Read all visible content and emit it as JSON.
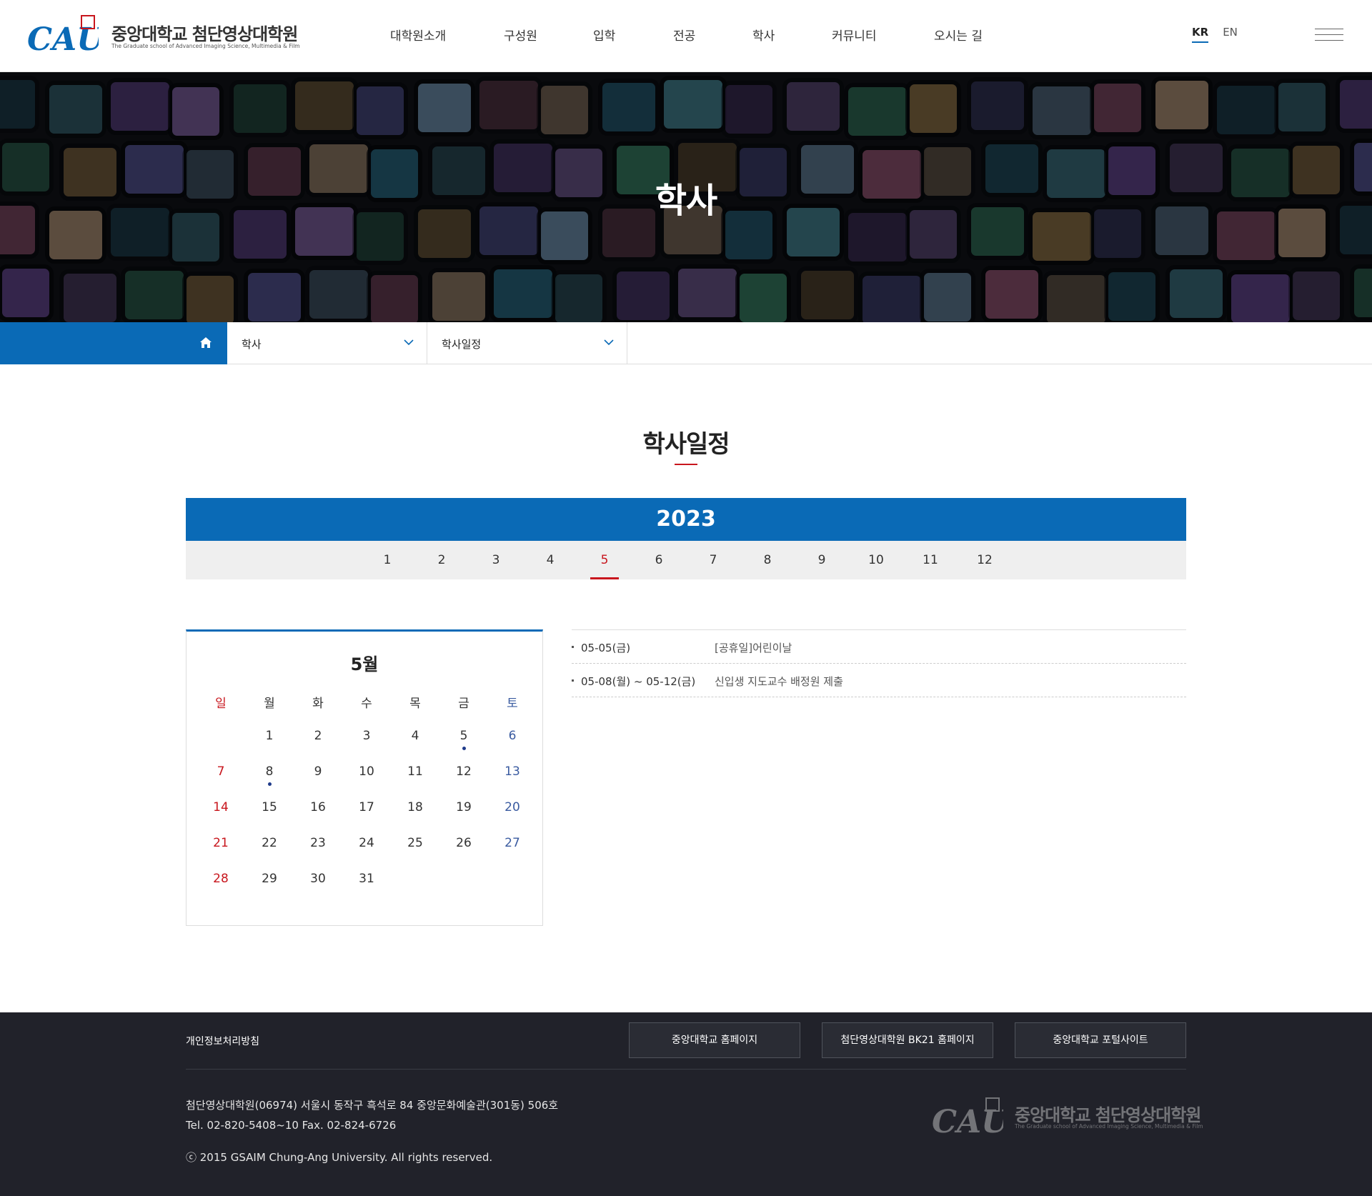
{
  "header": {
    "logo": {
      "mark": "CAU",
      "name_ko": "중앙대학교 첨단영상대학원",
      "name_en": "The Graduate school of Advanced Imaging Science, Multimedia & Film"
    },
    "nav": [
      "대학원소개",
      "구성원",
      "입학",
      "전공",
      "학사",
      "커뮤니티",
      "오시는 길"
    ],
    "lang": {
      "kr": "KR",
      "en": "EN",
      "active": "KR"
    }
  },
  "hero": {
    "title": "학사"
  },
  "breadcrumb": {
    "level1": "학사",
    "level2": "학사일정"
  },
  "page": {
    "title": "학사일정"
  },
  "schedule": {
    "year": "2023",
    "months": [
      "1",
      "2",
      "3",
      "4",
      "5",
      "6",
      "7",
      "8",
      "9",
      "10",
      "11",
      "12"
    ],
    "active_month": "5"
  },
  "calendar": {
    "title": "5월",
    "weekdays": [
      "일",
      "월",
      "화",
      "수",
      "목",
      "금",
      "토"
    ],
    "first_weekday": 1,
    "days": 31,
    "event_days": [
      5,
      8
    ]
  },
  "events": [
    {
      "date": "05-05(금)",
      "desc": "[공휴일]어린이날"
    },
    {
      "date": "05-08(월) ~ 05-12(금)",
      "desc": "신입생 지도교수 배정원 제출"
    }
  ],
  "footer": {
    "privacy": "개인정보처리방침",
    "links": [
      "중앙대학교 홈페이지",
      "첨단영상대학원 BK21 홈페이지",
      "중앙대학교 포털사이트"
    ],
    "address": "첨단영상대학원(06974) 서울시 동작구 흑석로 84 중앙문화예술관(301동) 506호",
    "tel": "Tel. 02-820-5408~10 Fax. 02-824-6726",
    "copyright": "ⓒ 2015 GSAIM Chung-Ang University. All rights reserved."
  },
  "colors": {
    "primary": "#0a6ab6",
    "accent": "#c8161d",
    "footer_bg": "#21222a",
    "saturday": "#3a5ba0"
  }
}
